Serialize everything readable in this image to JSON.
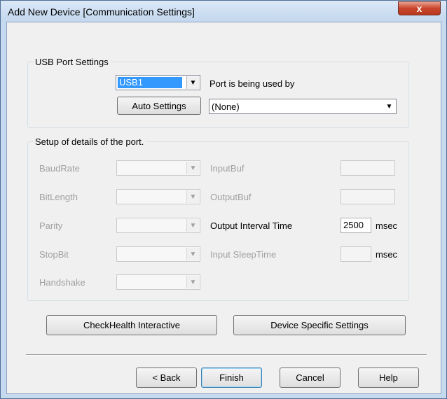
{
  "window": {
    "title": "Add New Device  [Communication Settings]",
    "close_glyph": "x"
  },
  "usb_group": {
    "legend": "USB Port Settings",
    "port_value": "USB1",
    "used_by_label": "Port is being used by",
    "used_by_value": "(None)",
    "auto_settings_label": "Auto Settings"
  },
  "details_group": {
    "legend": "Setup of details of the port.",
    "baudrate_label": "BaudRate",
    "bitlength_label": "BitLength",
    "parity_label": "Parity",
    "stopbit_label": "StopBit",
    "handshake_label": "Handshake",
    "inputbuf_label": "InputBuf",
    "outputbuf_label": "OutputBuf",
    "output_interval_label": "Output Interval Time",
    "output_interval_value": "2500",
    "output_interval_unit": "msec",
    "input_sleep_label": "Input SleepTime",
    "input_sleep_unit": "msec"
  },
  "actions": {
    "checkhealth_label": "CheckHealth Interactive",
    "device_specific_label": "Device Specific Settings"
  },
  "footer": {
    "back_label": "< Back",
    "finish_label": "Finish",
    "cancel_label": "Cancel",
    "help_label": "Help"
  },
  "colors": {
    "selection": "#3399ff",
    "close_button": "#c9442a",
    "disabled_text": "#a0a0a0"
  }
}
